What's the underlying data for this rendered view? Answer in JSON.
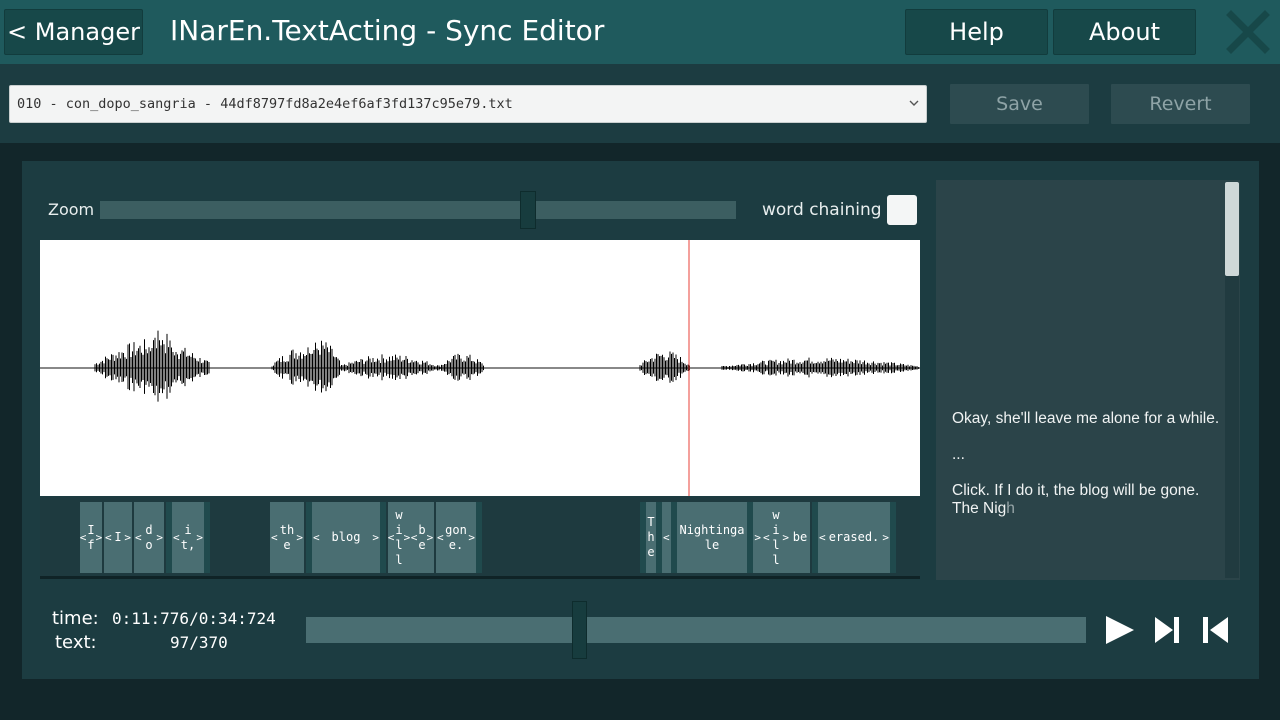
{
  "header": {
    "back_label": "< Manager",
    "title": "INarEn.TextActing - Sync Editor",
    "help_label": "Help",
    "about_label": "About"
  },
  "file_bar": {
    "selected_file": "010 - con_dopo_sangria - 44df8797fd8a2e4ef6af3fd137c95e79.txt",
    "save_label": "Save",
    "revert_label": "Revert"
  },
  "editor": {
    "zoom_label": "Zoom",
    "zoom_level": 0.7,
    "word_chaining_label": "word chaining",
    "word_chaining_checked": false,
    "playhead_fraction": 0.737
  },
  "words": [
    {
      "text": "If"
    },
    {
      "text": "I"
    },
    {
      "text": "do"
    },
    {
      "text": "it,"
    },
    {
      "text": "the"
    },
    {
      "text": "blog"
    },
    {
      "text": "will"
    },
    {
      "text": "be"
    },
    {
      "text": "gone."
    },
    {
      "text": "The"
    },
    {
      "text": "Nightingale"
    },
    {
      "text": "will"
    },
    {
      "text": "be"
    },
    {
      "text": "erased."
    }
  ],
  "transcript": {
    "line1": "Okay, she'll leave me alone for a while.",
    "line2": "...",
    "line3": "Click. If I do it, the blog will be gone. The Nig",
    "line3_fade": "h"
  },
  "playback": {
    "time_label": "time:",
    "time_value": "0:11:776/0:34:724",
    "text_label": "text:",
    "text_value": "97/370",
    "seek_fraction": 0.34
  },
  "colors": {
    "header_bg": "#1f5a5d",
    "panel_bg": "#1c3c41",
    "accent": "#4a6e72",
    "playhead": "#e8413a"
  },
  "icons": [
    "close-icon",
    "chevron-down-icon",
    "play-icon",
    "skip-forward-icon",
    "skip-back-icon"
  ]
}
